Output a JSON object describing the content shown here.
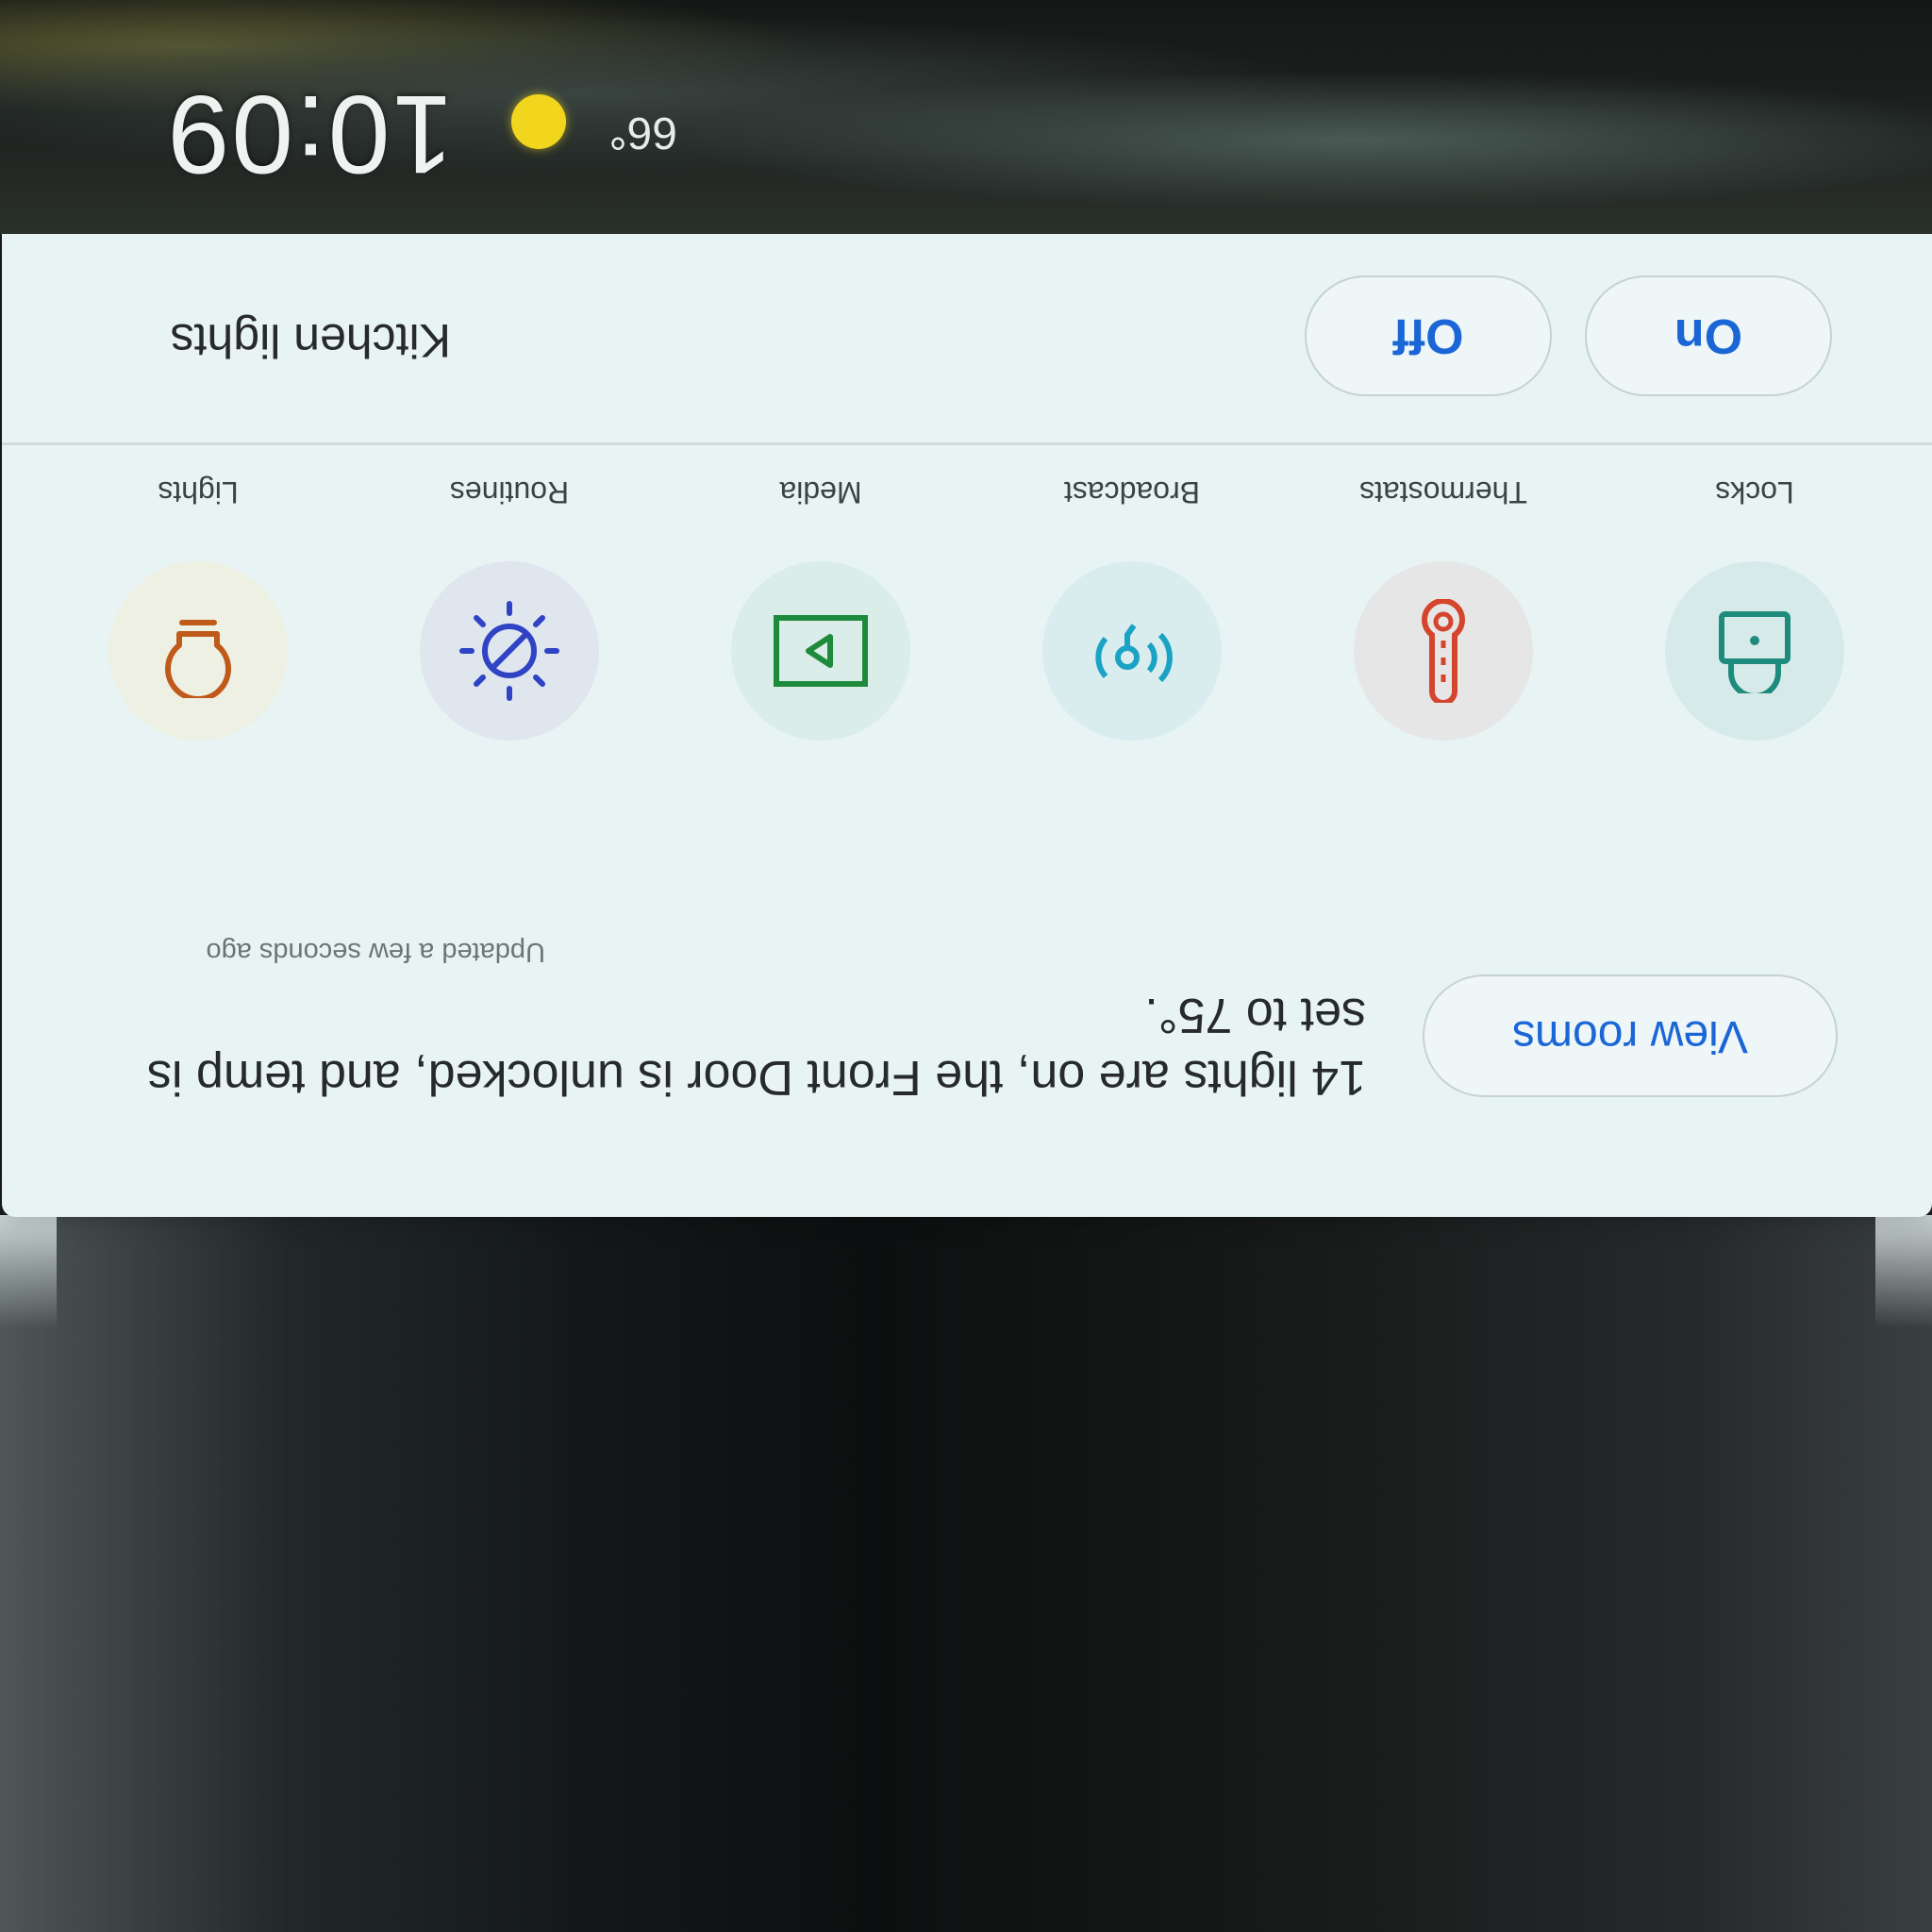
{
  "status": {
    "time": "10:09",
    "weather_icon": "sun-icon",
    "temperature": "66°"
  },
  "summary": {
    "text": "14 lights are on, the Front Door is unlocked, and temp is set to 75°.",
    "updated": "Updated a few seconds ago",
    "view_rooms_label": "View rooms"
  },
  "categories": [
    {
      "label": "Locks",
      "icon": "lock-icon",
      "color": "#1f8b7c"
    },
    {
      "label": "Thermostats",
      "icon": "thermometer-icon",
      "color": "#d4452e"
    },
    {
      "label": "Broadcast",
      "icon": "broadcast-icon",
      "color": "#1aa3c4"
    },
    {
      "label": "Media",
      "icon": "play-icon",
      "color": "#1e8a3c"
    },
    {
      "label": "Routines",
      "icon": "routine-sun-icon",
      "color": "#2f43c4"
    },
    {
      "label": "Lights",
      "icon": "lightbulb-icon",
      "color": "#c05a1a"
    }
  ],
  "kitchen": {
    "label": "Kitchen lights",
    "on_label": "On",
    "off_label": "Off"
  },
  "colors": {
    "accent": "#1a66d6",
    "card_background": "#e8f3f4"
  }
}
